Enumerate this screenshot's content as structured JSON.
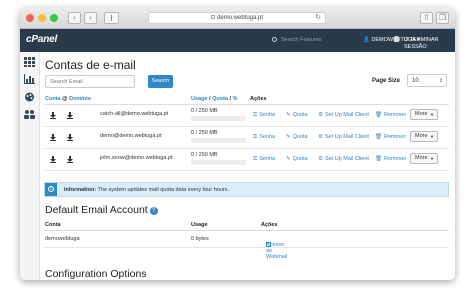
{
  "browser": {
    "url": "demo.webtuga.pt"
  },
  "topbar": {
    "logo": "cPanel",
    "search_placeholder": "Search Features",
    "user": "DEMOWEBTUGA",
    "logout": "TERMINAR SESSÃO"
  },
  "page": {
    "title": "Contas de e-mail",
    "search_placeholder": "Search Email",
    "search_button": "Search",
    "page_size_label": "Page Size",
    "page_size_value": "10"
  },
  "table": {
    "headers": {
      "account": "Conta",
      "at": "@",
      "domain": "Domínio",
      "usage": "Usage",
      "quota": "Quota",
      "percent": "%",
      "actions": "Ações"
    },
    "rows": [
      {
        "email": "catch-all@demo.webtuga.pt",
        "usage": "0 / 250 MB"
      },
      {
        "email": "demo@demo.webtuga.pt",
        "usage": "0 / 250 MB"
      },
      {
        "email": "john.snow@demo.webtuga.pt",
        "usage": "0 / 250 MB"
      }
    ],
    "actions": {
      "password": "Senha",
      "quota": "Quota",
      "mail_client": "Set Up Mail Client",
      "remove": "Remover",
      "more": "More"
    }
  },
  "info": {
    "label": "Information:",
    "text": "The system updates mail quota data every four hours."
  },
  "default_account": {
    "title": "Default Email Account",
    "headers": {
      "account": "Conta",
      "usage": "Usage",
      "actions": "Ações"
    },
    "account": "demowebtuga",
    "usage": "0 bytes",
    "webmail": "Acesso ao Webmail"
  },
  "config": {
    "title": "Configuration Options"
  },
  "colors": {
    "accent": "#2f86c8",
    "topbar": "#293a4a",
    "info_bg": "#d9ecf7"
  }
}
